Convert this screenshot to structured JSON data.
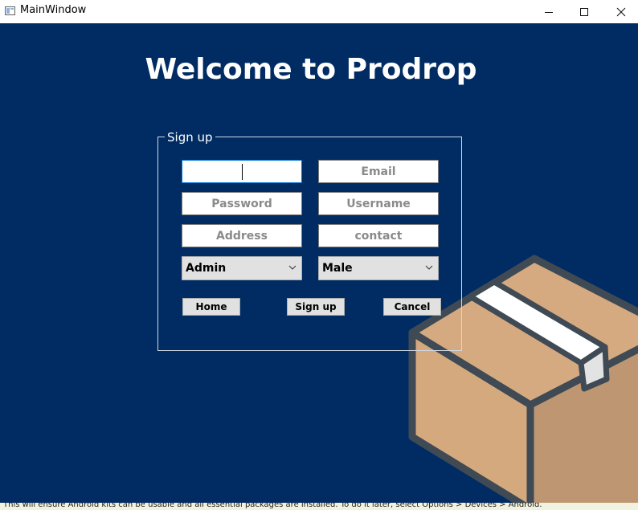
{
  "window": {
    "title": "MainWindow"
  },
  "header": {
    "welcome": "Welcome to Prodrop"
  },
  "signup": {
    "legend": "Sign up",
    "fields": {
      "name": {
        "value": "",
        "placeholder": ""
      },
      "email": {
        "value": "",
        "placeholder": "Email"
      },
      "password": {
        "value": "",
        "placeholder": "Password"
      },
      "username": {
        "value": "",
        "placeholder": "Username"
      },
      "address": {
        "value": "",
        "placeholder": "Address"
      },
      "contact": {
        "value": "",
        "placeholder": "contact"
      }
    },
    "role_select": {
      "selected": "Admin"
    },
    "gender_select": {
      "selected": "Male"
    },
    "buttons": {
      "home": "Home",
      "signup": "Sign up",
      "cancel": "Cancel"
    }
  },
  "status": {
    "text": "This will ensure Android kits can be usable and all essential packages are installed. To do it later, select Options > Devices > Android."
  },
  "icons": {
    "app": "app-window-icon",
    "minimize": "minimize-icon",
    "maximize": "maximize-icon",
    "close": "close-icon",
    "dropdown": "chevron-down-icon",
    "illustration": "cardboard-box-icon"
  },
  "colors": {
    "background": "#002c63",
    "box_side": "#d3a77d",
    "box_front": "#c39c75",
    "box_outline": "#3f4a55",
    "tape": "#ffffff"
  }
}
